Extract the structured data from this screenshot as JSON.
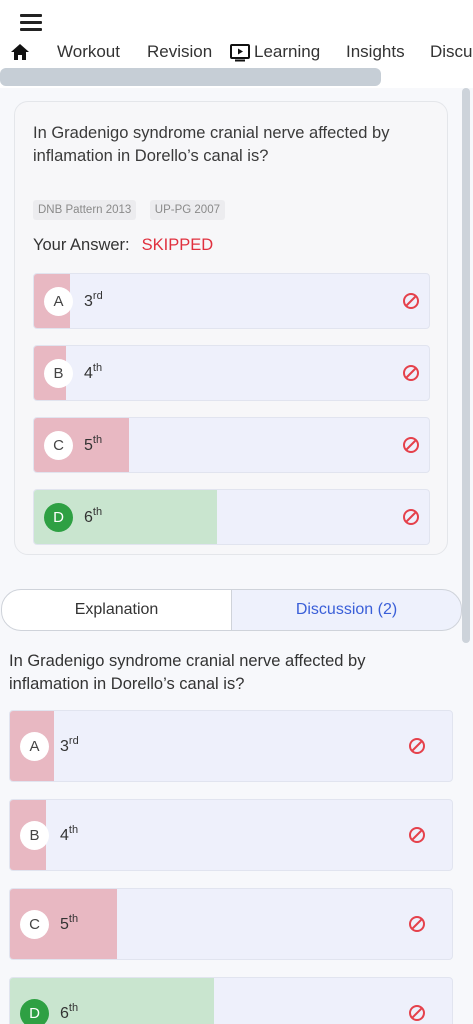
{
  "nav": {
    "tabs": [
      "Workout",
      "Revision",
      "Learning",
      "Insights",
      "Discu"
    ]
  },
  "question": {
    "text": "In Gradenigo syndrome cranial nerve affected by inflamation in Dorello’s canal is?",
    "tags": [
      "DNB Pattern 2013",
      "UP-PG 2007"
    ],
    "your_answer_label": "Your Answer:",
    "your_answer_value": "SKIPPED",
    "options": [
      {
        "letter": "A",
        "base": "3",
        "sup": "rd",
        "percent": 9,
        "correct": false
      },
      {
        "letter": "B",
        "base": "4",
        "sup": "th",
        "percent": 8,
        "correct": false
      },
      {
        "letter": "C",
        "base": "5",
        "sup": "th",
        "percent": 24,
        "correct": false
      },
      {
        "letter": "D",
        "base": "6",
        "sup": "th",
        "percent": 46,
        "correct": true
      }
    ]
  },
  "explanation_tabs": {
    "explanation": "Explanation",
    "discussion": "Discussion (2)"
  },
  "explanation": {
    "text": "In Gradenigo syndrome cranial nerve affected by inflamation in Dorello’s canal is?",
    "options": [
      {
        "letter": "A",
        "base": "3",
        "sup": "rd",
        "percent": 10,
        "correct": false
      },
      {
        "letter": "B",
        "base": "4",
        "sup": "th",
        "percent": 8,
        "correct": false
      },
      {
        "letter": "C",
        "base": "5",
        "sup": "th",
        "percent": 24,
        "correct": false
      },
      {
        "letter": "D",
        "base": "6",
        "sup": "th",
        "percent": 46,
        "correct": true
      }
    ]
  },
  "colors": {
    "wrong_fill": "#e8b8c2",
    "correct_fill": "#c9e5cf",
    "skipped": "#e0303e",
    "accent": "#3a5fd8"
  }
}
